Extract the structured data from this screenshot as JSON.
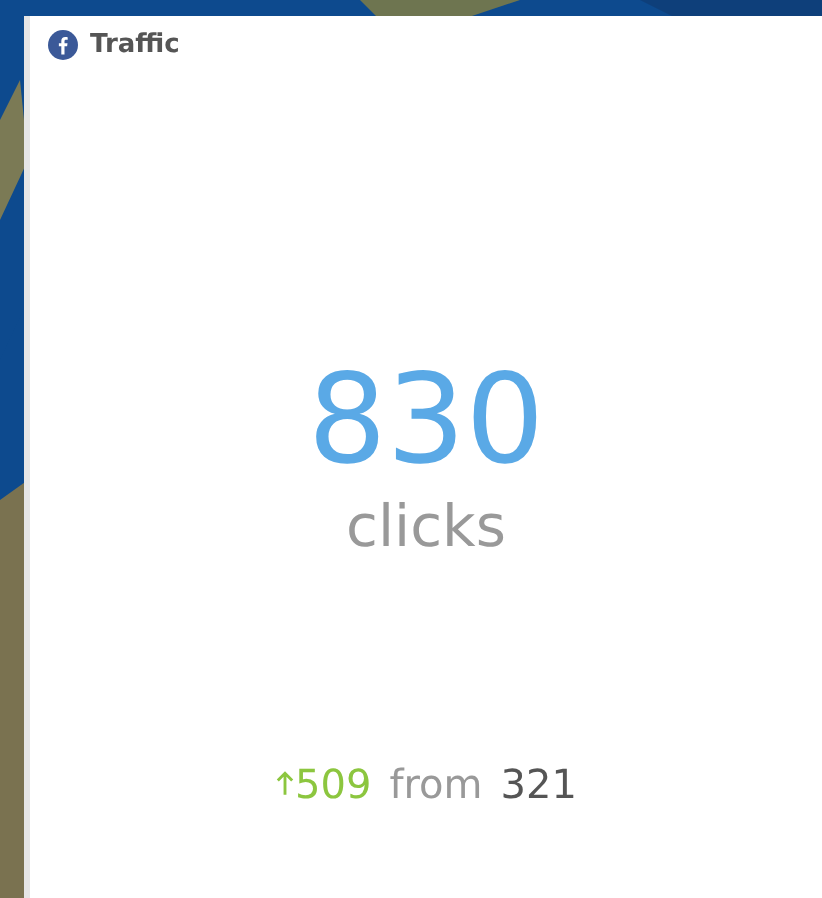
{
  "widget": {
    "title": "Traffic",
    "value": "830",
    "unit": "clicks",
    "change": {
      "up": true,
      "amount": "509",
      "from_label": "from",
      "previous": "321"
    }
  }
}
